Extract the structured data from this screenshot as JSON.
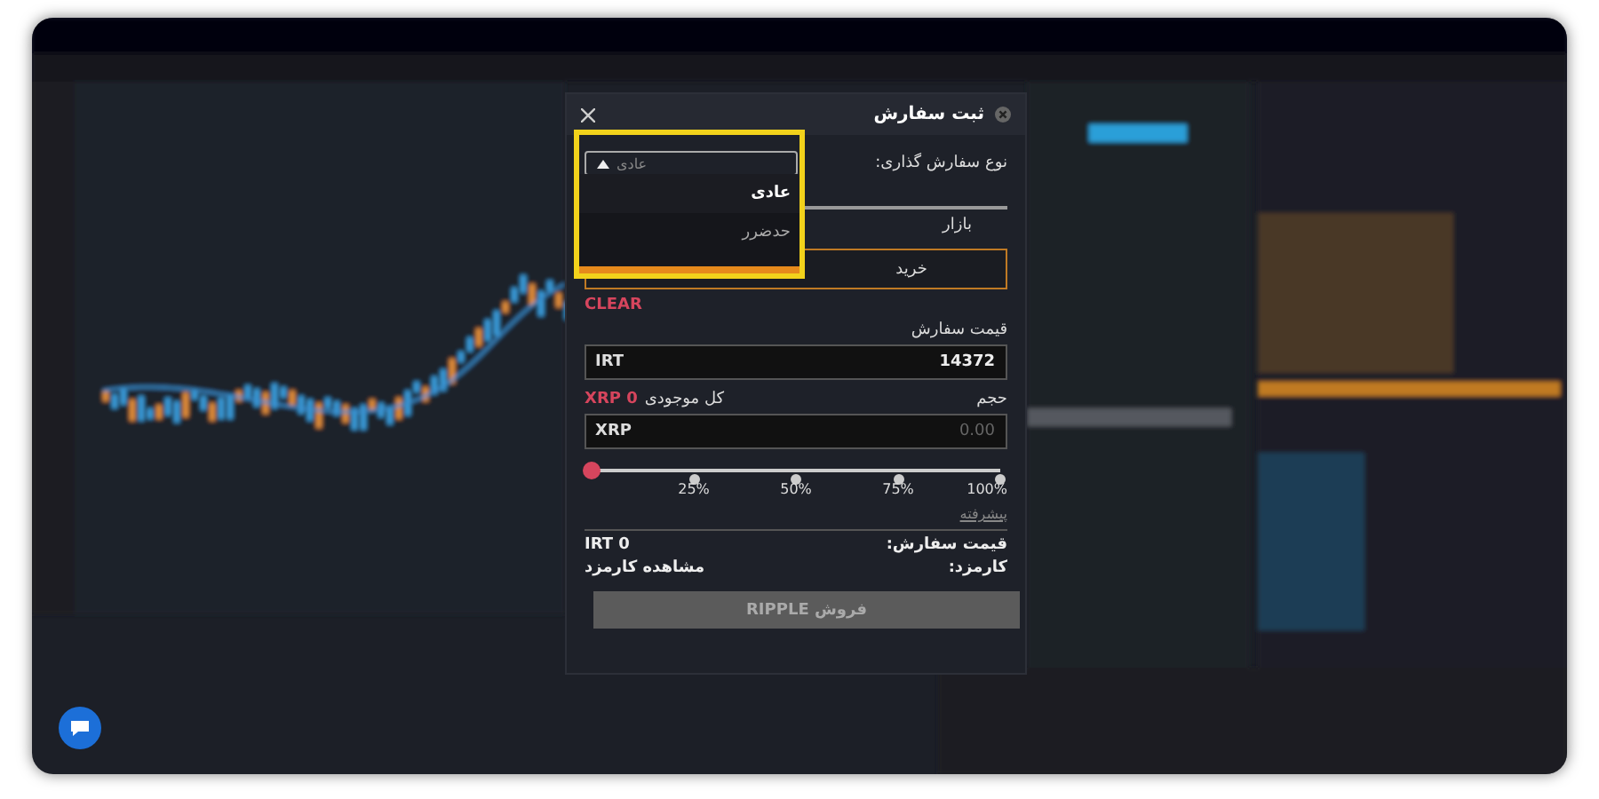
{
  "modal": {
    "title": "ثبت سفارش",
    "order_type": {
      "label": "نوع سفارش گذاری:",
      "value": "عادی",
      "expanded": true,
      "options": [
        {
          "label": "عادی",
          "selected": true
        },
        {
          "label": "حدضرر",
          "selected": false
        }
      ]
    },
    "market_label": "بازار",
    "side_button": "خرید",
    "clear": "CLEAR",
    "price": {
      "label": "قیمت سفارش",
      "unit": "IRT",
      "value": "14372"
    },
    "volume": {
      "label": "حجم",
      "balance_label": "کل موجودی",
      "balance": "XRP 0",
      "unit": "XRP",
      "placeholder": "0.00"
    },
    "slider": {
      "level": 0,
      "ticks": [
        "100%",
        "75%",
        "50%",
        "25%"
      ]
    },
    "advanced": "پیشرفته",
    "summary": [
      {
        "label": "قیمت سفارش:",
        "value": "IRT 0"
      },
      {
        "label": "کارمزد:",
        "value": "مشاهده کارمزد"
      }
    ],
    "submit": {
      "label": "فروش RIPPLE",
      "disabled": true
    }
  }
}
